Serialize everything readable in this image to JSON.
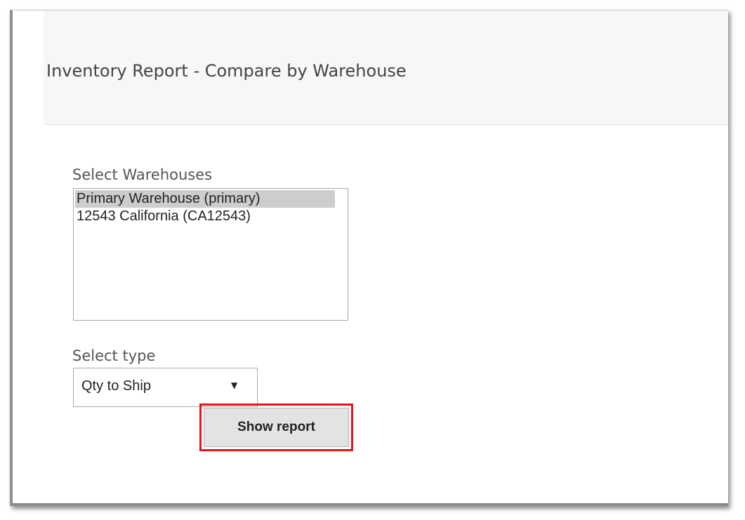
{
  "header": {
    "title": "Inventory Report - Compare by Warehouse"
  },
  "warehouses": {
    "label": "Select Warehouses",
    "options": [
      {
        "label": "Primary Warehouse (primary)",
        "selected": true
      },
      {
        "label": "12543 California (CA12543)",
        "selected": false
      }
    ]
  },
  "type_select": {
    "label": "Select type",
    "value": "Qty to Ship",
    "arrow_icon": "dropdown-arrow-icon"
  },
  "actions": {
    "show_report_label": "Show report",
    "highlight_color": "#e8141a"
  },
  "colors": {
    "header_bg": "#f7f7f7",
    "selected_option_bg": "#cdcdcd",
    "button_bg": "#e3e3e3"
  }
}
